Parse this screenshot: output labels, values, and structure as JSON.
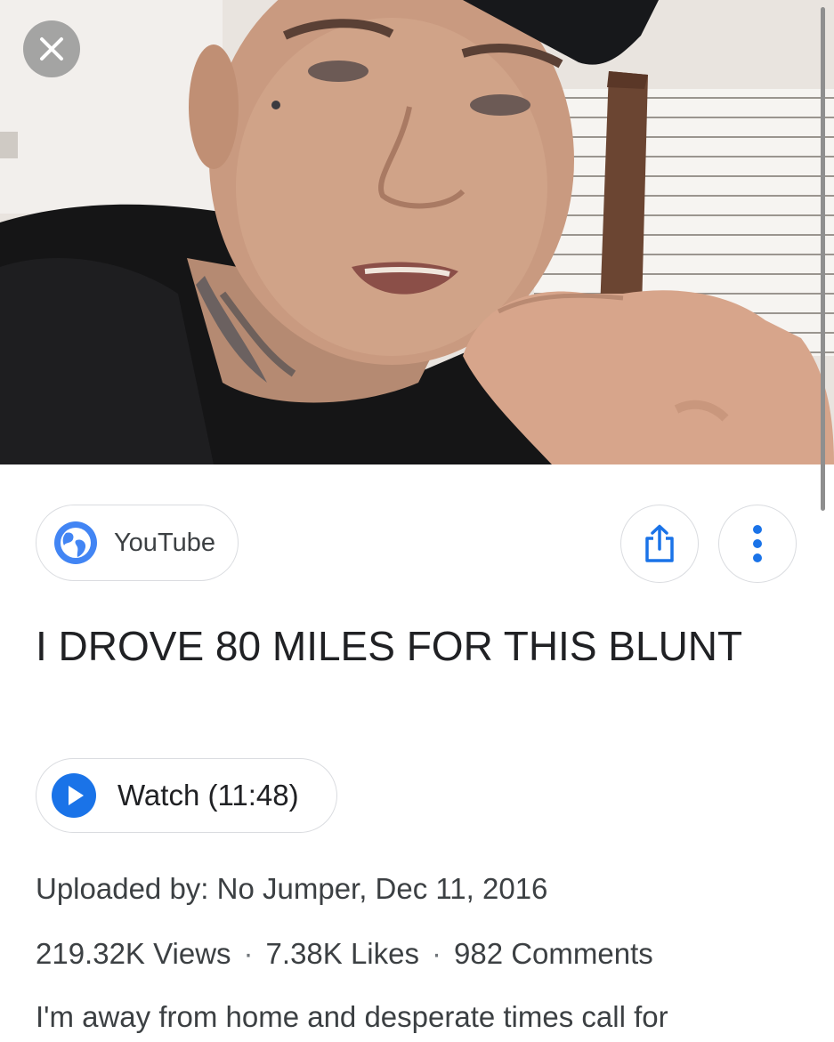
{
  "source": {
    "label": "YouTube",
    "icon": "globe-icon",
    "accent": "#4285f4"
  },
  "actions": {
    "share_icon": "share-icon",
    "more_icon": "more-vert-icon",
    "close_icon": "close-icon"
  },
  "video": {
    "title": "I DROVE 80 MILES FOR THIS BLUNT",
    "watch_label": "Watch (11:48)",
    "uploaded": "Uploaded by: No Jumper, Dec 11, 2016",
    "views": "219.32K Views",
    "likes": "7.38K Likes",
    "comments": "982 Comments",
    "separator": "·",
    "description": "I'm away from home and desperate times call for"
  }
}
